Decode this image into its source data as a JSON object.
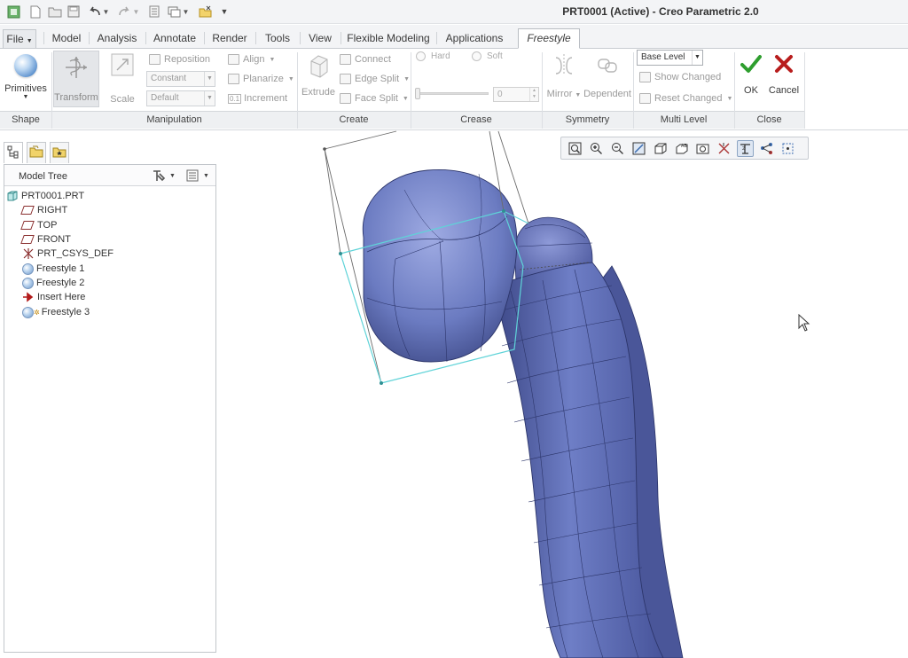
{
  "window": {
    "title": "PRT0001 (Active) - Creo Parametric 2.0"
  },
  "quick_access": {
    "icons": [
      "app-icon",
      "new-icon",
      "open-icon",
      "save-icon",
      "undo-icon",
      "redo-icon",
      "regenerate-icon",
      "windows-icon",
      "close-window-icon",
      "customize-icon"
    ]
  },
  "tabs": [
    {
      "label": "File"
    },
    {
      "label": "Model"
    },
    {
      "label": "Analysis"
    },
    {
      "label": "Annotate"
    },
    {
      "label": "Render"
    },
    {
      "label": "Tools"
    },
    {
      "label": "View"
    },
    {
      "label": "Flexible Modeling"
    },
    {
      "label": "Applications"
    },
    {
      "label": "Freestyle",
      "active": true
    }
  ],
  "ribbon": {
    "shape": {
      "group": "Shape",
      "primitives": "Primitives"
    },
    "manipulation": {
      "group": "Manipulation",
      "transform": "Transform",
      "scale": "Scale",
      "reposition": "Reposition",
      "constant": "Constant",
      "default": "Default",
      "align": "Align",
      "planarize": "Planarize",
      "increment": "Increment",
      "increment_badge": "0.1"
    },
    "create": {
      "group": "Create",
      "extrude": "Extrude",
      "connect": "Connect",
      "edge_split": "Edge Split",
      "face_split": "Face Split"
    },
    "crease": {
      "group": "Crease",
      "hard": "Hard",
      "soft": "Soft",
      "value": "0"
    },
    "symmetry": {
      "group": "Symmetry",
      "mirror": "Mirror",
      "dependent": "Dependent"
    },
    "multi_level": {
      "group": "Multi Level",
      "level": "Base Level",
      "show_changed": "Show Changed",
      "reset_changed": "Reset Changed"
    },
    "close": {
      "group": "Close",
      "ok": "OK",
      "cancel": "Cancel"
    }
  },
  "model_tree": {
    "title": "Model Tree",
    "items": [
      {
        "label": "PRT0001.PRT",
        "icon": "part-icon",
        "level": 0
      },
      {
        "label": "RIGHT",
        "icon": "datum-plane-icon",
        "level": 1
      },
      {
        "label": "TOP",
        "icon": "datum-plane-icon",
        "level": 1
      },
      {
        "label": "FRONT",
        "icon": "datum-plane-icon",
        "level": 1
      },
      {
        "label": "PRT_CSYS_DEF",
        "icon": "csys-icon",
        "level": 1
      },
      {
        "label": "Freestyle 1",
        "icon": "freestyle-icon",
        "level": 1
      },
      {
        "label": "Freestyle 2",
        "icon": "freestyle-icon",
        "level": 1
      },
      {
        "label": "Insert Here",
        "icon": "insert-arrow-icon",
        "level": 1
      },
      {
        "label": "Freestyle 3",
        "icon": "freestyle-active-icon",
        "level": 1
      }
    ]
  },
  "colors": {
    "model_fill": "#6f7fc4",
    "model_dark": "#3e4a86",
    "model_light": "#9aa6df",
    "selection": "#5fd3d8",
    "ok_green": "#2e9e2e",
    "cancel_red": "#b81d1d",
    "datum_red": "#8a2f2f"
  }
}
